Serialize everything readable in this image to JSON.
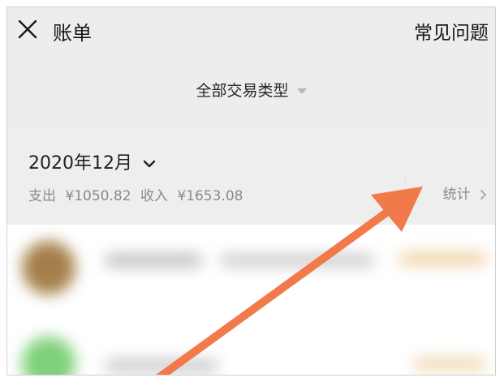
{
  "header": {
    "title": "账单",
    "faq_label": "常见问题"
  },
  "filter": {
    "label": "全部交易类型"
  },
  "month_section": {
    "month": "2020年12月",
    "expense_label": "支出",
    "expense_value": "¥1050.82",
    "income_label": "收入",
    "income_value": "¥1653.08",
    "stats_label": "统计"
  },
  "colors": {
    "annotation_arrow": "#f27a4a",
    "background": "#ededed"
  },
  "icons": {
    "close": "close-icon",
    "month_dropdown": "chevron-down-icon",
    "stats": "chevron-right-icon",
    "filter": "caret-down-icon"
  }
}
